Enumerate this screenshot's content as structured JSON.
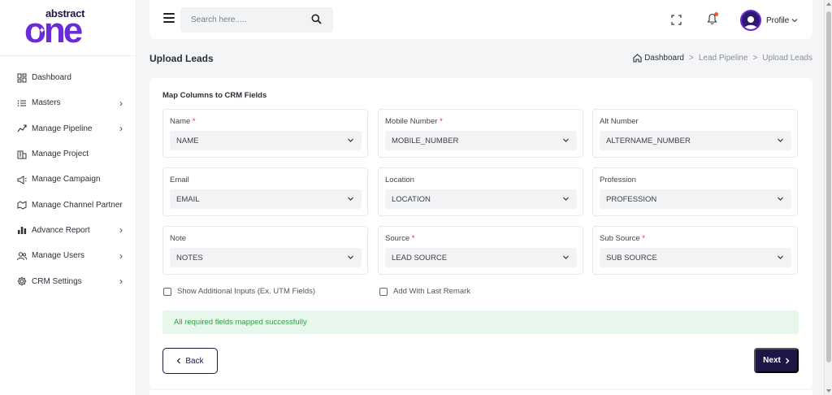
{
  "brand": {
    "top": "abstract",
    "bottom": "one"
  },
  "sidebar": {
    "items": [
      {
        "label": "Dashboard",
        "icon": "grid-icon",
        "has_chevron": false
      },
      {
        "label": "Masters",
        "icon": "list-icon",
        "has_chevron": true
      },
      {
        "label": "Manage Pipeline",
        "icon": "pipeline-icon",
        "has_chevron": true
      },
      {
        "label": "Manage Project",
        "icon": "building-icon",
        "has_chevron": false
      },
      {
        "label": "Manage Campaign",
        "icon": "megaphone-icon",
        "has_chevron": false
      },
      {
        "label": "Manage Channel Partner",
        "icon": "handshake-icon",
        "has_chevron": false
      },
      {
        "label": "Advance Report",
        "icon": "bar-chart-icon",
        "has_chevron": true
      },
      {
        "label": "Manage Users",
        "icon": "users-icon",
        "has_chevron": true
      },
      {
        "label": "CRM Settings",
        "icon": "gear-icon",
        "has_chevron": true
      }
    ]
  },
  "topbar": {
    "search_placeholder": "Search here.....",
    "profile_label": "Profile"
  },
  "page": {
    "title": "Upload Leads",
    "breadcrumb": [
      "Dashboard",
      "Lead Pipeline",
      "Upload Leads"
    ]
  },
  "form": {
    "title": "Map Columns to CRM Fields",
    "fields": [
      {
        "label": "Name",
        "required": true,
        "value": "NAME"
      },
      {
        "label": "Mobile Number",
        "required": true,
        "value": "MOBILE_NUMBER"
      },
      {
        "label": "Alt Number",
        "required": false,
        "value": "ALTERNAME_NUMBER"
      },
      {
        "label": "Email",
        "required": false,
        "value": "EMAIL"
      },
      {
        "label": "Location",
        "required": false,
        "value": "LOCATION"
      },
      {
        "label": "Profession",
        "required": false,
        "value": "PROFESSION"
      },
      {
        "label": "Note",
        "required": false,
        "value": "NOTES"
      },
      {
        "label": "Source",
        "required": true,
        "value": "LEAD SOURCE"
      },
      {
        "label": "Sub Source",
        "required": true,
        "value": "SUB SOURCE"
      }
    ],
    "checkboxes": [
      {
        "label": "Show Additional Inputs (Ex. UTM Fields)",
        "checked": false
      },
      {
        "label": "Add With Last Remark",
        "checked": false
      }
    ],
    "alert": "All required fields mapped successfully",
    "back_label": "Back",
    "next_label": "Next"
  },
  "colors": {
    "brand": "#1c1744",
    "accent": "#6a2bd9",
    "success_bg": "#e8f7ec",
    "success_text": "#2f9e44",
    "required": "#e03131"
  }
}
